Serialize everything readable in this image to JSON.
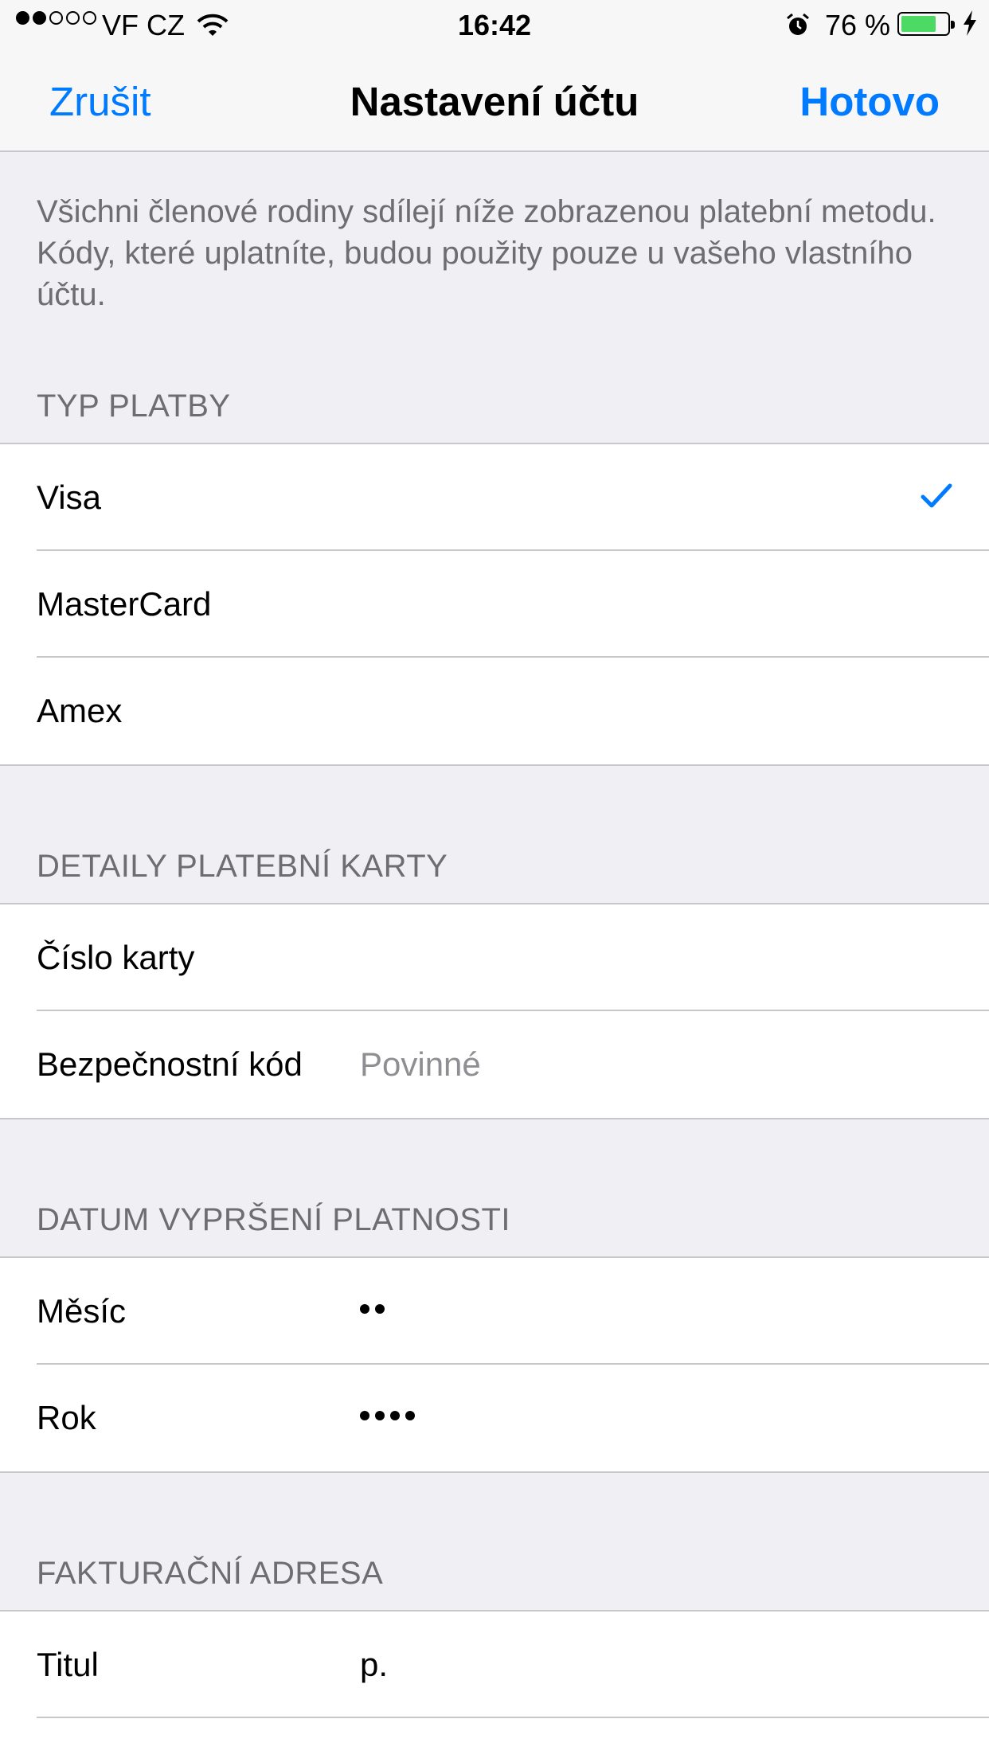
{
  "status_bar": {
    "carrier": "VF CZ",
    "signal_bars_filled": 2,
    "signal_bars_total": 5,
    "time": "16:42",
    "battery_percent": "76 %",
    "battery_level": 0.76,
    "battery_color": "#4cd964",
    "icons": [
      "wifi-icon",
      "alarm-icon",
      "battery-icon",
      "charging-bolt-icon"
    ]
  },
  "nav": {
    "cancel_label": "Zrušit",
    "title": "Nastavení účtu",
    "done_label": "Hotovo",
    "accent_color": "#007aff"
  },
  "intro": {
    "text": "Všichni členové rodiny sdílejí níže zobrazenou platební metodu. Kódy, které uplatníte, budou použity pouze u vašeho vlastního účtu."
  },
  "payment_type": {
    "header": "TYP PLATBY",
    "options": [
      {
        "label": "Visa",
        "selected": true
      },
      {
        "label": "MasterCard",
        "selected": false
      },
      {
        "label": "Amex",
        "selected": false
      }
    ]
  },
  "card_details": {
    "header": "DETAILY PLATEBNÍ KARTY",
    "card_number_label": "Číslo karty",
    "card_number_value": "",
    "security_code_label": "Bezpečnostní kód",
    "security_code_placeholder": "Povinné"
  },
  "expiry": {
    "header": "DATUM VYPRŠENÍ PLATNOSTI",
    "month_label": "Měsíc",
    "month_masked_length": 2,
    "year_label": "Rok",
    "year_masked_length": 4
  },
  "billing": {
    "header": "FAKTURAČNÍ ADRESA",
    "title_label": "Titul",
    "title_value": "p."
  }
}
